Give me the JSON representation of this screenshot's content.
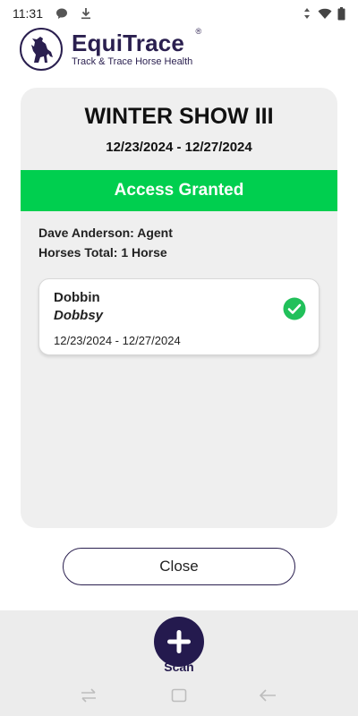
{
  "status_bar": {
    "time": "11:31",
    "icons": [
      "chat-bubble-icon",
      "download-icon",
      "signal-icon",
      "wifi-icon",
      "battery-icon"
    ]
  },
  "brand": {
    "name": "EquiTrace",
    "registered": "®",
    "tagline": "Track & Trace Horse Health",
    "color": "#2a1f4f"
  },
  "event": {
    "title": "WINTER SHOW III",
    "dates": "12/23/2024 - 12/27/2024",
    "access_status": "Access Granted",
    "access_color": "#00cf4f",
    "agent_line": "Dave Anderson: Agent",
    "horses_total": "Horses Total: 1 Horse"
  },
  "horses": [
    {
      "name": "Dobbin",
      "nickname": "Dobbsy",
      "dates": "12/23/2024 - 12/27/2024",
      "status_icon": "check-circle-icon",
      "status_color": "#21c05a"
    }
  ],
  "actions": {
    "close_label": "Close",
    "scan_label": "Scan"
  },
  "nav": {
    "icons": [
      "recent-apps-icon",
      "home-icon",
      "back-icon"
    ]
  }
}
